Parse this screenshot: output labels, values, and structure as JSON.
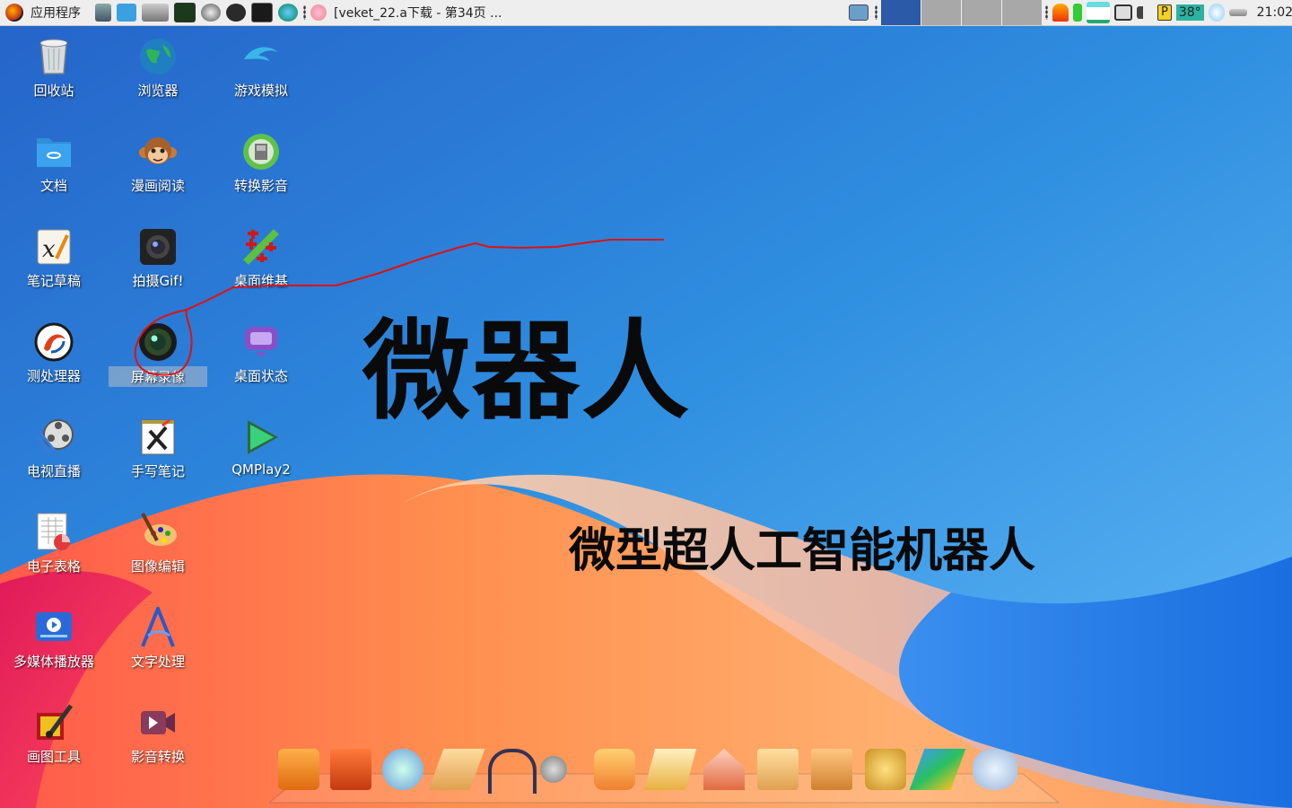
{
  "taskbar": {
    "apps_label": "应用程序",
    "window_title": "[veket_22.a下载 - 第34页 ...",
    "temperature": "38°",
    "clock": "21:02",
    "parking_badge": "P"
  },
  "desktop": {
    "icons": [
      {
        "label": "回收站",
        "icon": "trash-icon"
      },
      {
        "label": "浏览器",
        "icon": "globe-icon"
      },
      {
        "label": "游戏模拟",
        "icon": "dolphin-icon"
      },
      {
        "label": "文档",
        "icon": "folder-icon"
      },
      {
        "label": "漫画阅读",
        "icon": "monkey-icon"
      },
      {
        "label": "转换影音",
        "icon": "convert-icon"
      },
      {
        "label": "笔记草稿",
        "icon": "xournal-icon"
      },
      {
        "label": "拍摄Gif!",
        "icon": "camera-icon"
      },
      {
        "label": "桌面维基",
        "icon": "wiki-icon"
      },
      {
        "label": "测处理器",
        "icon": "cpu-swirl-icon"
      },
      {
        "label": "屏幕录像",
        "icon": "lens-icon"
      },
      {
        "label": "桌面状态",
        "icon": "monitor-status-icon"
      },
      {
        "label": "电视直播",
        "icon": "film-reel-icon"
      },
      {
        "label": "手写笔记",
        "icon": "handwriting-icon"
      },
      {
        "label": "QMPlay2",
        "icon": "play-triangle-icon"
      },
      {
        "label": "电子表格",
        "icon": "spreadsheet-icon"
      },
      {
        "label": "图像编辑",
        "icon": "palette-icon"
      },
      {
        "label": "多媒体播放器",
        "icon": "media-player-icon"
      },
      {
        "label": "文字处理",
        "icon": "abiword-icon"
      },
      {
        "label": "画图工具",
        "icon": "paint-icon"
      },
      {
        "label": "影音转换",
        "icon": "video-convert-icon"
      }
    ]
  },
  "wallpaper": {
    "title": "微器人",
    "subtitle": "微型超人工智能机器人"
  },
  "colors": {
    "annotation": "#e01010",
    "wave_orange": "#ff8a50",
    "wave_red": "#f0305a",
    "sky": "#2f8fe0"
  }
}
